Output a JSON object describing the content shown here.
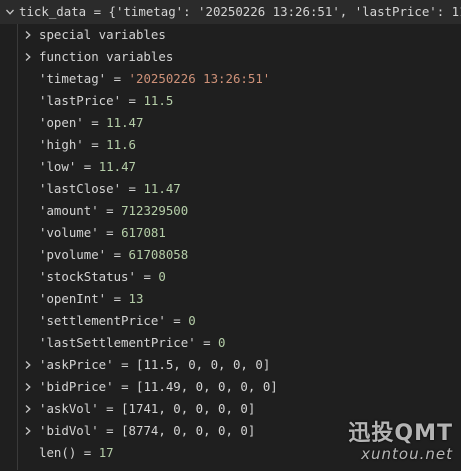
{
  "root": {
    "name": "tick_data",
    "summary": "{'timetag': '20250226 13:26:51', 'lastPrice': 11"
  },
  "groups": [
    {
      "label": "special variables"
    },
    {
      "label": "function variables"
    }
  ],
  "fields": [
    {
      "key": "'timetag'",
      "value": "'20250226 13:26:51'",
      "kind": "str"
    },
    {
      "key": "'lastPrice'",
      "value": "11.5",
      "kind": "num"
    },
    {
      "key": "'open'",
      "value": "11.47",
      "kind": "num"
    },
    {
      "key": "'high'",
      "value": "11.6",
      "kind": "num"
    },
    {
      "key": "'low'",
      "value": "11.47",
      "kind": "num"
    },
    {
      "key": "'lastClose'",
      "value": "11.47",
      "kind": "num"
    },
    {
      "key": "'amount'",
      "value": "712329500",
      "kind": "num"
    },
    {
      "key": "'volume'",
      "value": "617081",
      "kind": "num"
    },
    {
      "key": "'pvolume'",
      "value": "61708058",
      "kind": "num"
    },
    {
      "key": "'stockStatus'",
      "value": "0",
      "kind": "num"
    },
    {
      "key": "'openInt'",
      "value": "13",
      "kind": "num"
    },
    {
      "key": "'settlementPrice'",
      "value": "0",
      "kind": "num"
    },
    {
      "key": "'lastSettlementPrice'",
      "value": "0",
      "kind": "num"
    }
  ],
  "lists": [
    {
      "key": "'askPrice'",
      "value": "[11.5, 0, 0, 0, 0]"
    },
    {
      "key": "'bidPrice'",
      "value": "[11.49, 0, 0, 0, 0]"
    },
    {
      "key": "'askVol'",
      "value": "[1741, 0, 0, 0, 0]"
    },
    {
      "key": "'bidVol'",
      "value": "[8774, 0, 0, 0, 0]"
    }
  ],
  "len_row": {
    "label": "len()",
    "value": "17"
  },
  "watermark": {
    "title": "迅投QMT",
    "url": "xuntou.net"
  },
  "colors": {
    "background": "#1f1f1f",
    "string": "#ce9178",
    "number": "#b5cea8",
    "text": "#d4d4d4"
  }
}
